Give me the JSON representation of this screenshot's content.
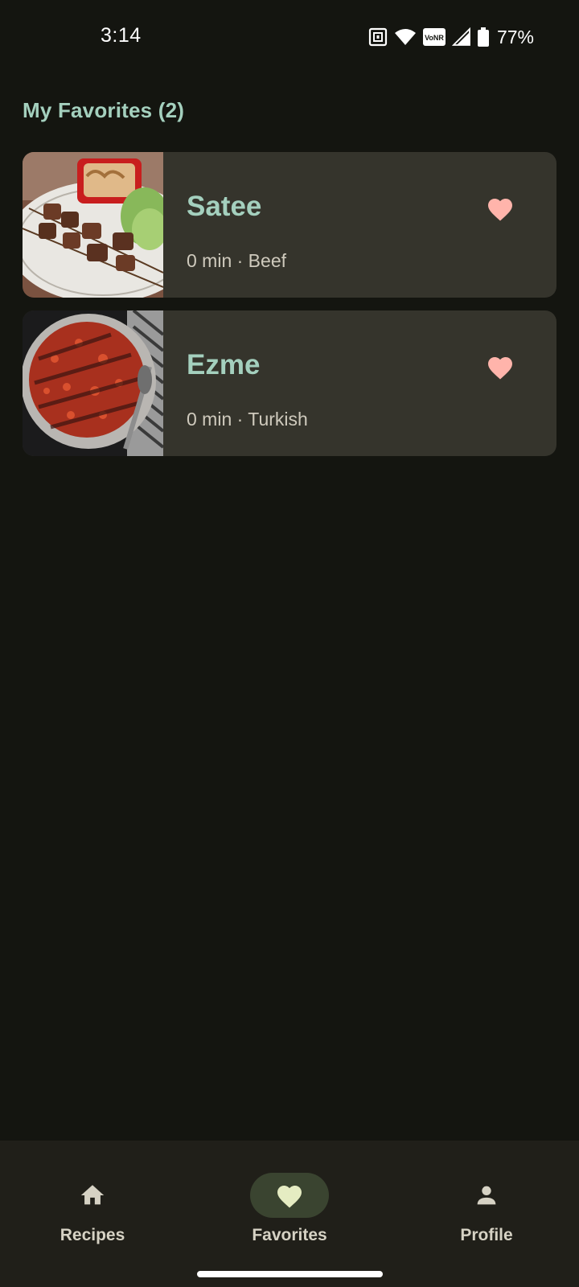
{
  "status_bar": {
    "time": "3:14",
    "battery": "77%",
    "icons": [
      "nfc-icon",
      "wifi-icon",
      "vonr-icon",
      "signal-icon",
      "battery-icon"
    ],
    "vonr_label": "VoNR"
  },
  "page": {
    "title": "My Favorites (2)"
  },
  "favorites": [
    {
      "name": "Satee",
      "meta": "0 min · Beef",
      "favorited": true
    },
    {
      "name": "Ezme",
      "meta": "0 min · Turkish",
      "favorited": true
    }
  ],
  "nav": {
    "items": [
      {
        "label": "Recipes",
        "icon": "home-icon",
        "active": false
      },
      {
        "label": "Favorites",
        "icon": "heart-icon",
        "active": true
      },
      {
        "label": "Profile",
        "icon": "person-icon",
        "active": false
      }
    ]
  },
  "colors": {
    "background": "#141510",
    "card": "#35342c",
    "accent_text": "#a4d0be",
    "heart": "#ffb4ab",
    "nav_background": "#201f19",
    "nav_active_pill": "#3a4430"
  }
}
